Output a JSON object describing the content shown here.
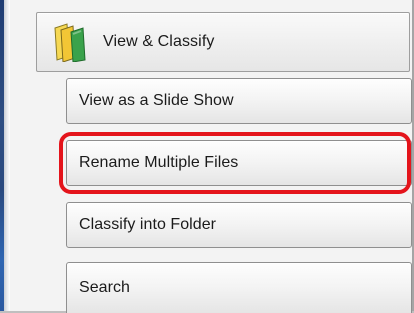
{
  "category": {
    "label": "View & Classify",
    "icon": "folder-icon"
  },
  "items": [
    {
      "label": "View as a Slide Show"
    },
    {
      "label": "Rename Multiple Files"
    },
    {
      "label": "Classify into Folder"
    },
    {
      "label": "Search"
    }
  ],
  "colors": {
    "highlight": "#e4141b",
    "folder_yellow": "#f4d24a",
    "folder_green": "#39a34a"
  }
}
